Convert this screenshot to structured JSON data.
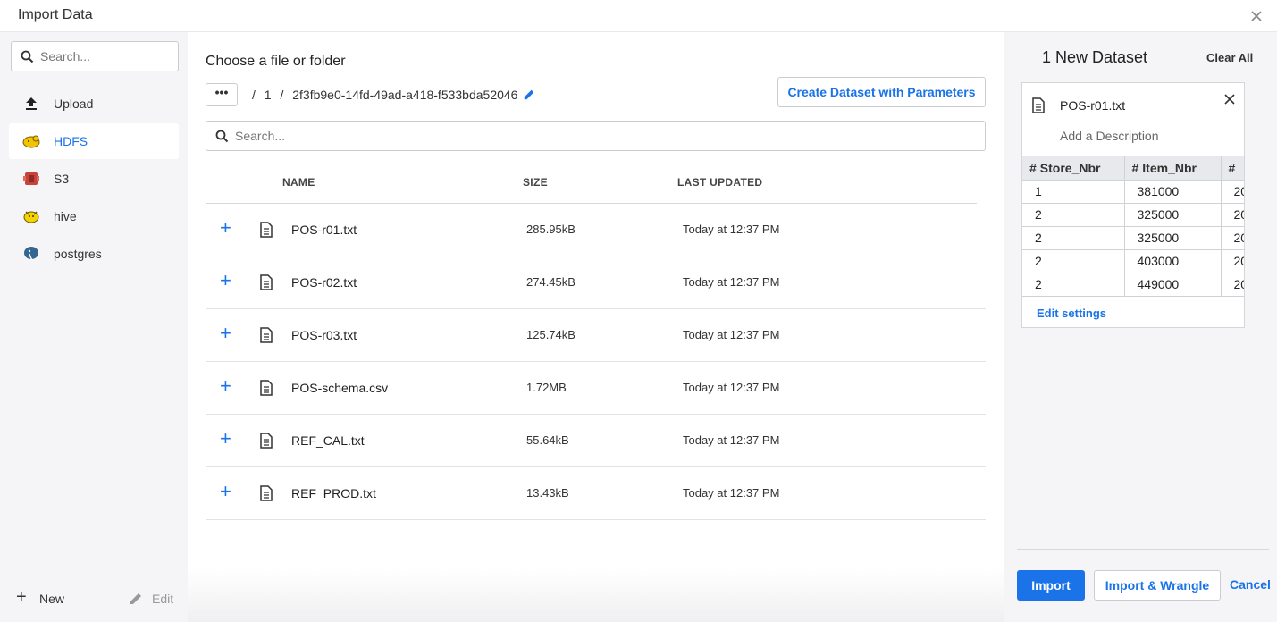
{
  "window": {
    "title": "Import Data"
  },
  "sidebar": {
    "search_placeholder": "Search...",
    "items": [
      {
        "label": "Upload",
        "icon": "upload-icon"
      },
      {
        "label": "HDFS",
        "icon": "hadoop-icon",
        "active": true
      },
      {
        "label": "S3",
        "icon": "s3-icon"
      },
      {
        "label": "hive",
        "icon": "hive-icon"
      },
      {
        "label": "postgres",
        "icon": "postgres-icon"
      }
    ],
    "new_label": "New",
    "edit_label": "Edit"
  },
  "main": {
    "heading": "Choose a file or folder",
    "more_label": "•••",
    "breadcrumbs": [
      "/",
      "1",
      "/",
      "2f3fb9e0-14fd-49ad-a418-f533bda52046"
    ],
    "create_dataset_label": "Create Dataset with Parameters",
    "search_placeholder": "Search...",
    "columns": {
      "name": "NAME",
      "size": "SIZE",
      "updated": "LAST UPDATED"
    },
    "files": [
      {
        "name": "POS-r01.txt",
        "size": "285.95kB",
        "updated": "Today at 12:37 PM"
      },
      {
        "name": "POS-r02.txt",
        "size": "274.45kB",
        "updated": "Today at 12:37 PM"
      },
      {
        "name": "POS-r03.txt",
        "size": "125.74kB",
        "updated": "Today at 12:37 PM"
      },
      {
        "name": "POS-schema.csv",
        "size": "1.72MB",
        "updated": "Today at 12:37 PM"
      },
      {
        "name": "REF_CAL.txt",
        "size": "55.64kB",
        "updated": "Today at 12:37 PM"
      },
      {
        "name": "REF_PROD.txt",
        "size": "13.43kB",
        "updated": "Today at 12:37 PM"
      }
    ]
  },
  "panel": {
    "heading": "1 New Dataset",
    "clear_all": "Clear All",
    "dataset": {
      "file_name": "POS-r01.txt",
      "description_placeholder": "Add a Description",
      "columns": [
        "Store_Nbr",
        "Item_Nbr",
        ""
      ],
      "rows": [
        [
          "1",
          "381000",
          "20"
        ],
        [
          "2",
          "325000",
          "20"
        ],
        [
          "2",
          "325000",
          "20"
        ],
        [
          "2",
          "403000",
          "20"
        ],
        [
          "2",
          "449000",
          "20"
        ]
      ],
      "edit_settings": "Edit settings"
    },
    "import_label": "Import",
    "import_wrangle_label": "Import & Wrangle",
    "cancel_label": "Cancel"
  },
  "colors": {
    "accent": "#1a73e8",
    "sidebar_bg": "#f5f5f7"
  }
}
